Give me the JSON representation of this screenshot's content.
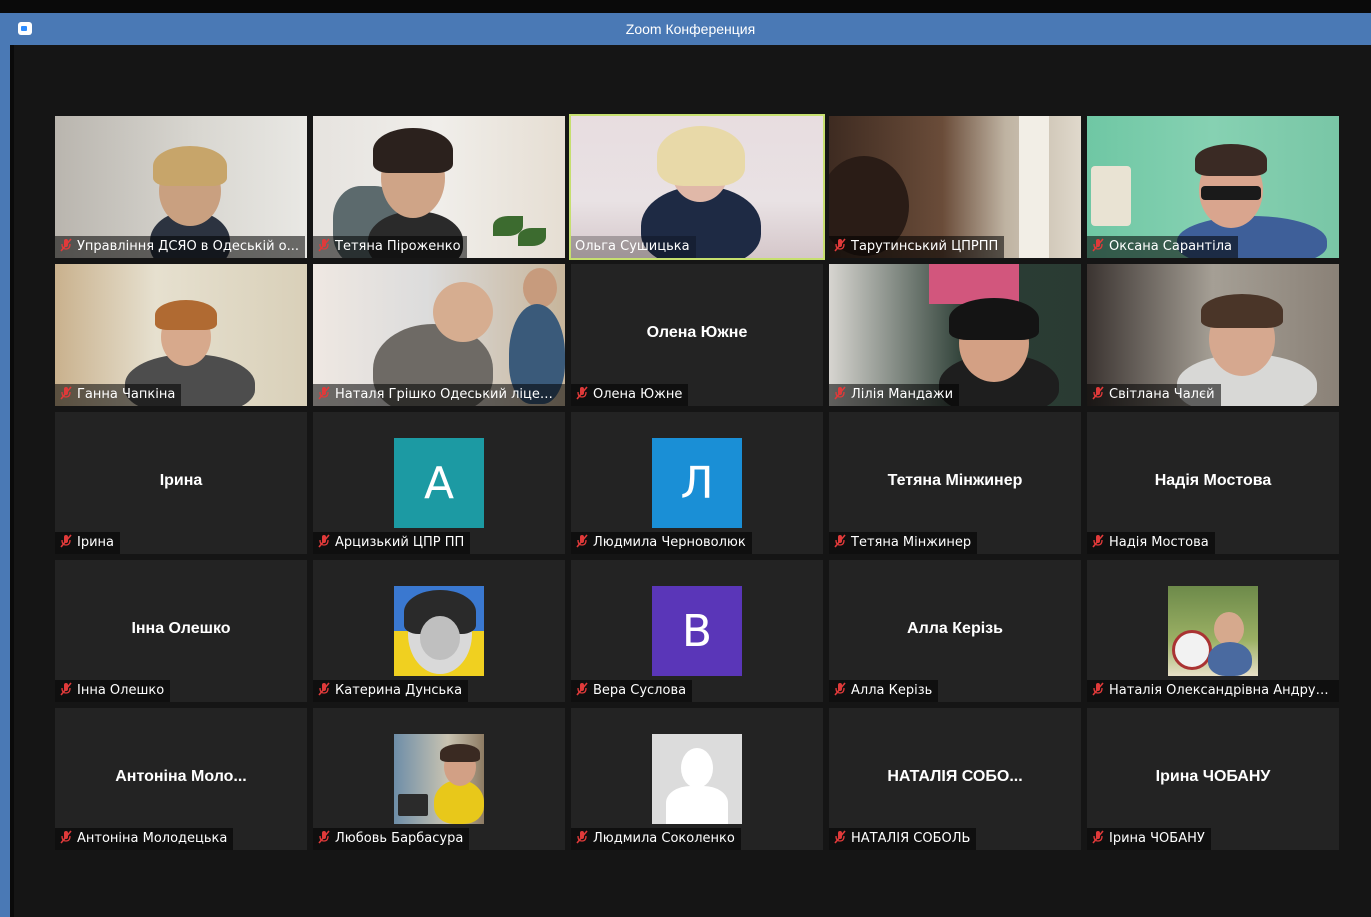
{
  "window": {
    "title": "Zoom Конференция"
  },
  "colors": {
    "titlebar": "#4a79b5",
    "active_speaker": "#c6df6f",
    "muted_icon": "#e03a3a"
  },
  "participants": [
    {
      "nameplate": "Управління ДСЯО в Одеській о...",
      "type": "video",
      "muted": true
    },
    {
      "nameplate": "Тетяна Піроженко",
      "type": "video",
      "muted": true
    },
    {
      "nameplate": "Ольга Сушицька",
      "type": "video",
      "muted": false,
      "active_speaker": true
    },
    {
      "nameplate": "Тарутинський ЦПРПП",
      "type": "video",
      "muted": true
    },
    {
      "nameplate": "Оксана Сарантіла",
      "type": "video",
      "muted": true
    },
    {
      "nameplate": "Ганна Чапкіна",
      "type": "video",
      "muted": true
    },
    {
      "nameplate": "Наталя Грішко Одеський ліцей ...",
      "type": "video",
      "muted": true
    },
    {
      "nameplate": "Олена Южне",
      "display": "Олена Южне",
      "type": "name",
      "muted": true
    },
    {
      "nameplate": "Лілія Мандажи",
      "type": "video",
      "muted": true
    },
    {
      "nameplate": "Світлана Чалєй",
      "type": "video",
      "muted": true
    },
    {
      "nameplate": "Ірина",
      "display": "Ірина",
      "type": "name",
      "muted": true
    },
    {
      "nameplate": "Арцизький ЦПР ПП",
      "avatar_letter": "А",
      "avatar_color": "#1c9aa3",
      "type": "letter",
      "muted": true
    },
    {
      "nameplate": "Людмила Черноволюк",
      "avatar_letter": "Л",
      "avatar_color": "#1a8fd6",
      "type": "letter",
      "muted": true
    },
    {
      "nameplate": "Тетяна Мінжинер",
      "display": "Тетяна Мінжинер",
      "type": "name",
      "muted": true
    },
    {
      "nameplate": "Надія Мостова",
      "display": "Надія Мостова",
      "type": "name",
      "muted": true
    },
    {
      "nameplate": "Інна Олешко",
      "display": "Інна Олешко",
      "type": "name",
      "muted": true
    },
    {
      "nameplate": "Катерина Дунська",
      "type": "photo",
      "muted": true
    },
    {
      "nameplate": "Вера Суслова",
      "avatar_letter": "В",
      "avatar_color": "#5a36b8",
      "type": "letter",
      "muted": true
    },
    {
      "nameplate": "Алла Керізь",
      "display": "Алла Керізь",
      "type": "name",
      "muted": true
    },
    {
      "nameplate": "Наталія Олександрівна Андруш...",
      "type": "photo",
      "muted": true
    },
    {
      "nameplate": "Антоніна Молодецька",
      "display": "Антоніна Моло...",
      "type": "name",
      "muted": true
    },
    {
      "nameplate": "Любовь Барбасура",
      "type": "photo",
      "muted": true
    },
    {
      "nameplate": "Людмила Соколенко",
      "type": "silhouette",
      "muted": true
    },
    {
      "nameplate": "НАТАЛІЯ СОБОЛЬ",
      "display": "НАТАЛІЯ СОБО...",
      "type": "name",
      "muted": true
    },
    {
      "nameplate": "Ірина ЧОБАНУ",
      "display": "Ірина ЧОБАНУ",
      "type": "name",
      "muted": true
    }
  ]
}
